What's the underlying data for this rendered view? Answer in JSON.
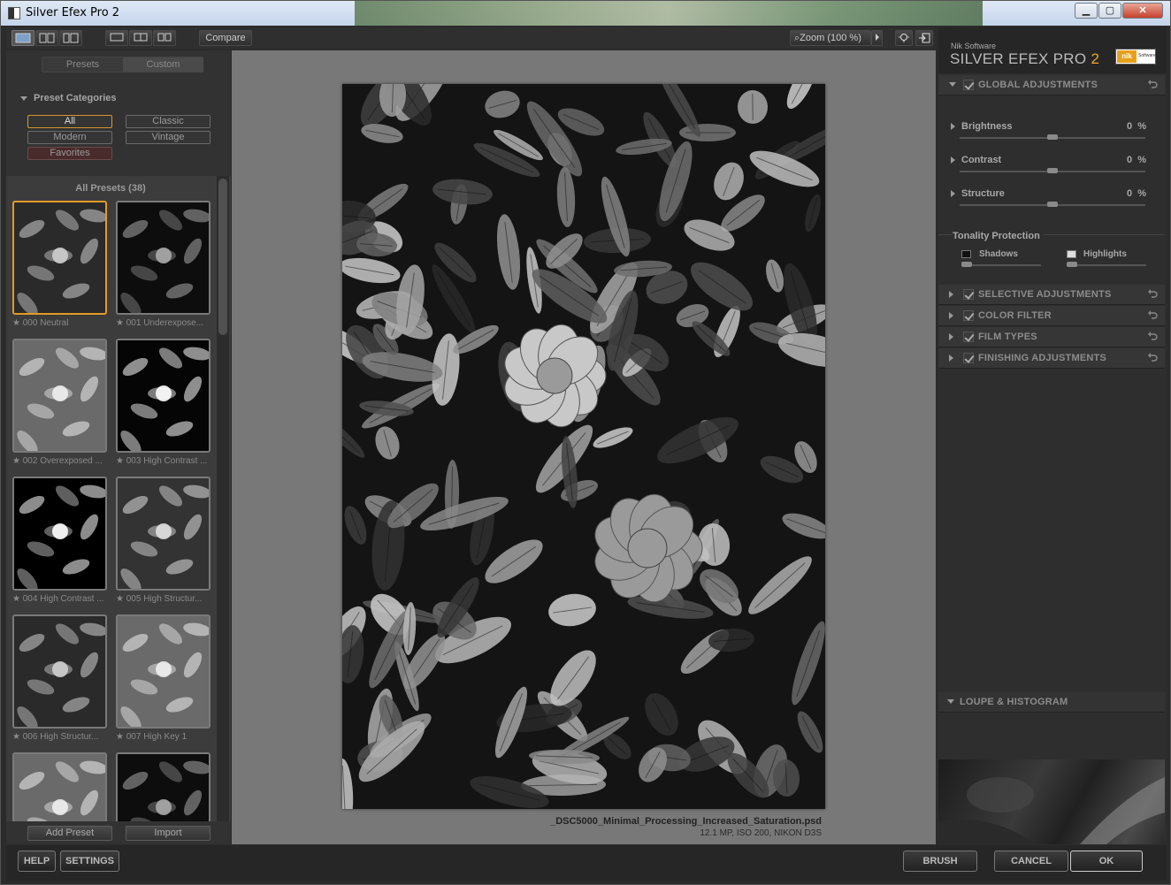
{
  "window": {
    "title": "Silver Efex Pro 2",
    "minimize": "▁",
    "maximize": "▢",
    "close": "✕"
  },
  "toolbar": {
    "compare": "Compare",
    "zoom": "Zoom (100 %)"
  },
  "left": {
    "tabs": [
      "Presets",
      "Custom"
    ],
    "categories_title": "Preset Categories",
    "categories": [
      "All",
      "Classic",
      "Modern",
      "Vintage",
      "Favorites"
    ],
    "all_presets": "All Presets (38)",
    "presets": [
      {
        "label": "000 Neutral",
        "tone": "neutral"
      },
      {
        "label": "001 Underexpose...",
        "tone": "dark"
      },
      {
        "label": "002 Overexposed ...",
        "tone": "light"
      },
      {
        "label": "003 High Contrast ...",
        "tone": "contrast"
      },
      {
        "label": "004 High Contrast ...",
        "tone": "contrast2"
      },
      {
        "label": "005 High Structur...",
        "tone": "structure"
      },
      {
        "label": "006 High Structur...",
        "tone": "neutral"
      },
      {
        "label": "007 High Key 1",
        "tone": "light"
      },
      {
        "label": "",
        "tone": "light"
      },
      {
        "label": "",
        "tone": "dark"
      }
    ],
    "add_preset": "Add Preset",
    "import": "Import"
  },
  "image": {
    "filename": "_DSC5000_Minimal_Processing_Increased_Saturation.psd",
    "info": "12.1 MP, ISO 200, NIKON D3S"
  },
  "right": {
    "brand_company": "Nik Software",
    "brand_product": "SILVER EFEX PRO",
    "brand_version": "2",
    "logo_text": "nik",
    "logo_sub": "Software",
    "global": "GLOBAL ADJUSTMENTS",
    "adjustments": [
      {
        "name": "Brightness",
        "value": "0",
        "unit": "%",
        "level": 0.5
      },
      {
        "name": "Contrast",
        "value": "0",
        "unit": "%",
        "level": 0.5
      },
      {
        "name": "Structure",
        "value": "0",
        "unit": "%",
        "level": 0.5
      }
    ],
    "tonality": "Tonality Protection",
    "shadows": "Shadows",
    "highlights": "Highlights",
    "sections": [
      "SELECTIVE ADJUSTMENTS",
      "COLOR FILTER",
      "FILM TYPES",
      "FINISHING ADJUSTMENTS"
    ],
    "loupe": "LOUPE & HISTOGRAM"
  },
  "footer": {
    "help": "HELP",
    "settings": "SETTINGS",
    "brush": "BRUSH",
    "cancel": "CANCEL",
    "ok": "OK"
  }
}
